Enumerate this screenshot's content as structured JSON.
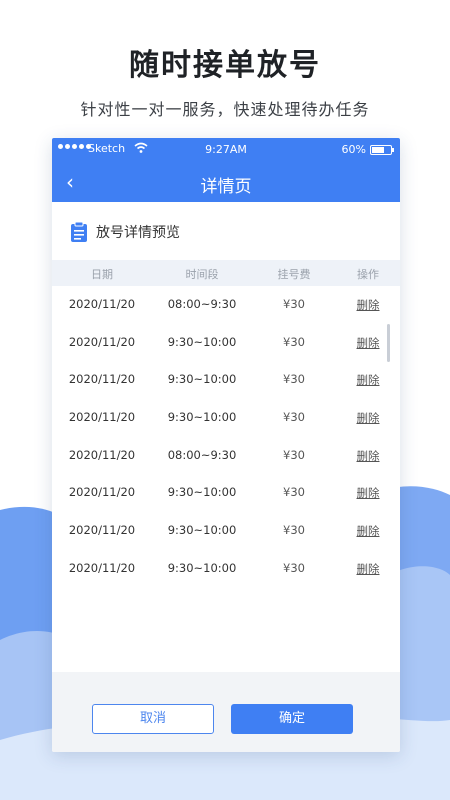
{
  "promo": {
    "title": "随时接单放号",
    "subtitle": "针对性一对一服务，快速处理待办任务"
  },
  "status_bar": {
    "carrier": "Sketch",
    "time": "9:27AM",
    "battery": "60%"
  },
  "nav": {
    "title": "详情页",
    "back_icon": "chevron-left-icon",
    "back_glyph": "‹"
  },
  "card": {
    "title": "放号详情预览",
    "icon": "clipboard-icon"
  },
  "table": {
    "headers": {
      "date": "日期",
      "time": "时间段",
      "fee": "挂号费",
      "op": "操作"
    },
    "rows": [
      {
        "date": "2020/11/20",
        "time": "08:00~9:30",
        "fee": "¥30",
        "op": "删除"
      },
      {
        "date": "2020/11/20",
        "time": "9:30~10:00",
        "fee": "¥30",
        "op": "删除"
      },
      {
        "date": "2020/11/20",
        "time": "9:30~10:00",
        "fee": "¥30",
        "op": "删除"
      },
      {
        "date": "2020/11/20",
        "time": "9:30~10:00",
        "fee": "¥30",
        "op": "删除"
      },
      {
        "date": "2020/11/20",
        "time": "08:00~9:30",
        "fee": "¥30",
        "op": "删除"
      },
      {
        "date": "2020/11/20",
        "time": "9:30~10:00",
        "fee": "¥30",
        "op": "删除"
      },
      {
        "date": "2020/11/20",
        "time": "9:30~10:00",
        "fee": "¥30",
        "op": "删除"
      },
      {
        "date": "2020/11/20",
        "time": "9:30~10:00",
        "fee": "¥30",
        "op": "删除"
      }
    ]
  },
  "footer": {
    "cancel_label": "取消",
    "confirm_label": "确定"
  },
  "colors": {
    "accent": "#3f7ff3",
    "cloud_dark": "#6e9ff2",
    "cloud_light": "#dbe8fb"
  }
}
